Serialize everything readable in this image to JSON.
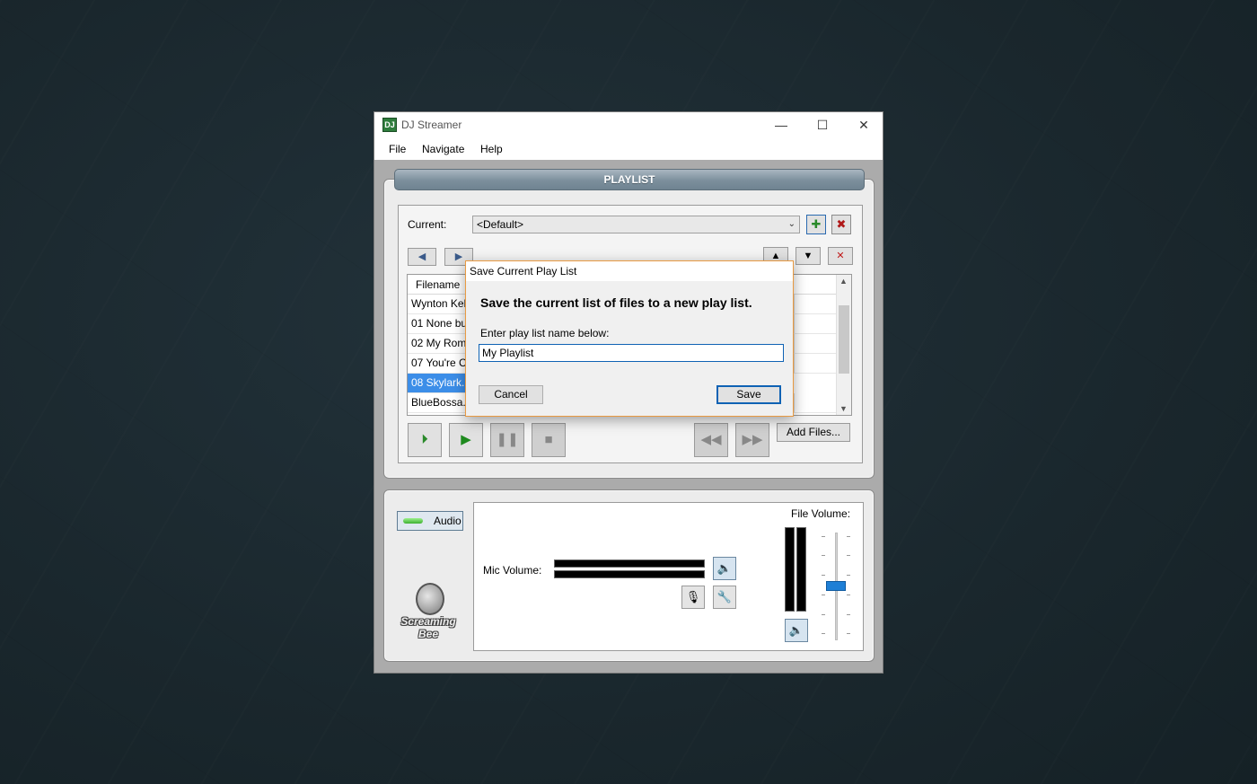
{
  "window": {
    "title": "DJ Streamer",
    "app_icon_text": "DJ",
    "controls": {
      "minimize": "—",
      "maximize": "☐",
      "close": "✕"
    }
  },
  "menu": [
    "File",
    "Navigate",
    "Help"
  ],
  "playlist": {
    "header": "PLAYLIST",
    "current_label": "Current:",
    "current_value": "<Default>",
    "column_header": "Filename",
    "rows": [
      {
        "name": "Wynton Kelly",
        "selected": false
      },
      {
        "name": "01 None but",
        "selected": false
      },
      {
        "name": "02 My Roma",
        "selected": false
      },
      {
        "name": "07 You're Cra",
        "selected": false
      },
      {
        "name": "08 Skylark.m",
        "selected": true
      },
      {
        "name": "BlueBossa.m",
        "selected": false
      }
    ],
    "add_files_label": "Add Files..."
  },
  "audio": {
    "toggle_label": "Audio",
    "mic_volume_label": "Mic Volume:",
    "file_volume_label": "File Volume:",
    "file_volume_level": 0.5,
    "logo_line1": "Screaming",
    "logo_line2": "Bee"
  },
  "dialog": {
    "title": "Save Current Play List",
    "heading": "Save the current list of files to a new play list.",
    "prompt": "Enter play list name below:",
    "input_value": "My Playlist",
    "cancel_label": "Cancel",
    "save_label": "Save"
  },
  "colors": {
    "accent": "#0f62b4",
    "selection": "#3c8ee8",
    "dialog_border": "#e89a42",
    "desktop": "#1a272d"
  }
}
